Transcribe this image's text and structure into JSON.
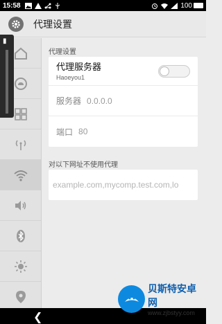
{
  "status_bar": {
    "time": "15:58",
    "battery": "100"
  },
  "title_bar": {
    "title": "代理设置"
  },
  "content": {
    "section_title": "代理设置",
    "proxy": {
      "title": "代理服务器",
      "subtitle": "Haoeyou1",
      "enabled": false
    },
    "server": {
      "label": "服务器",
      "value": "0.0.0.0"
    },
    "port": {
      "label": "端口",
      "value": "80"
    },
    "exclude_title": "对以下网址不使用代理",
    "exclude_placeholder": "example.com,mycomp.test.com,lo"
  },
  "sidebar": {
    "items": [
      "home-icon",
      "cloud-icon",
      "apps-grid-icon",
      "antenna-icon",
      "wifi-icon",
      "volume-icon",
      "bluetooth-icon",
      "brightness-icon",
      "location-icon"
    ],
    "active": "wifi-icon"
  },
  "watermark": {
    "main": "贝斯特安卓网",
    "url": "www.zjbstyy.com"
  }
}
